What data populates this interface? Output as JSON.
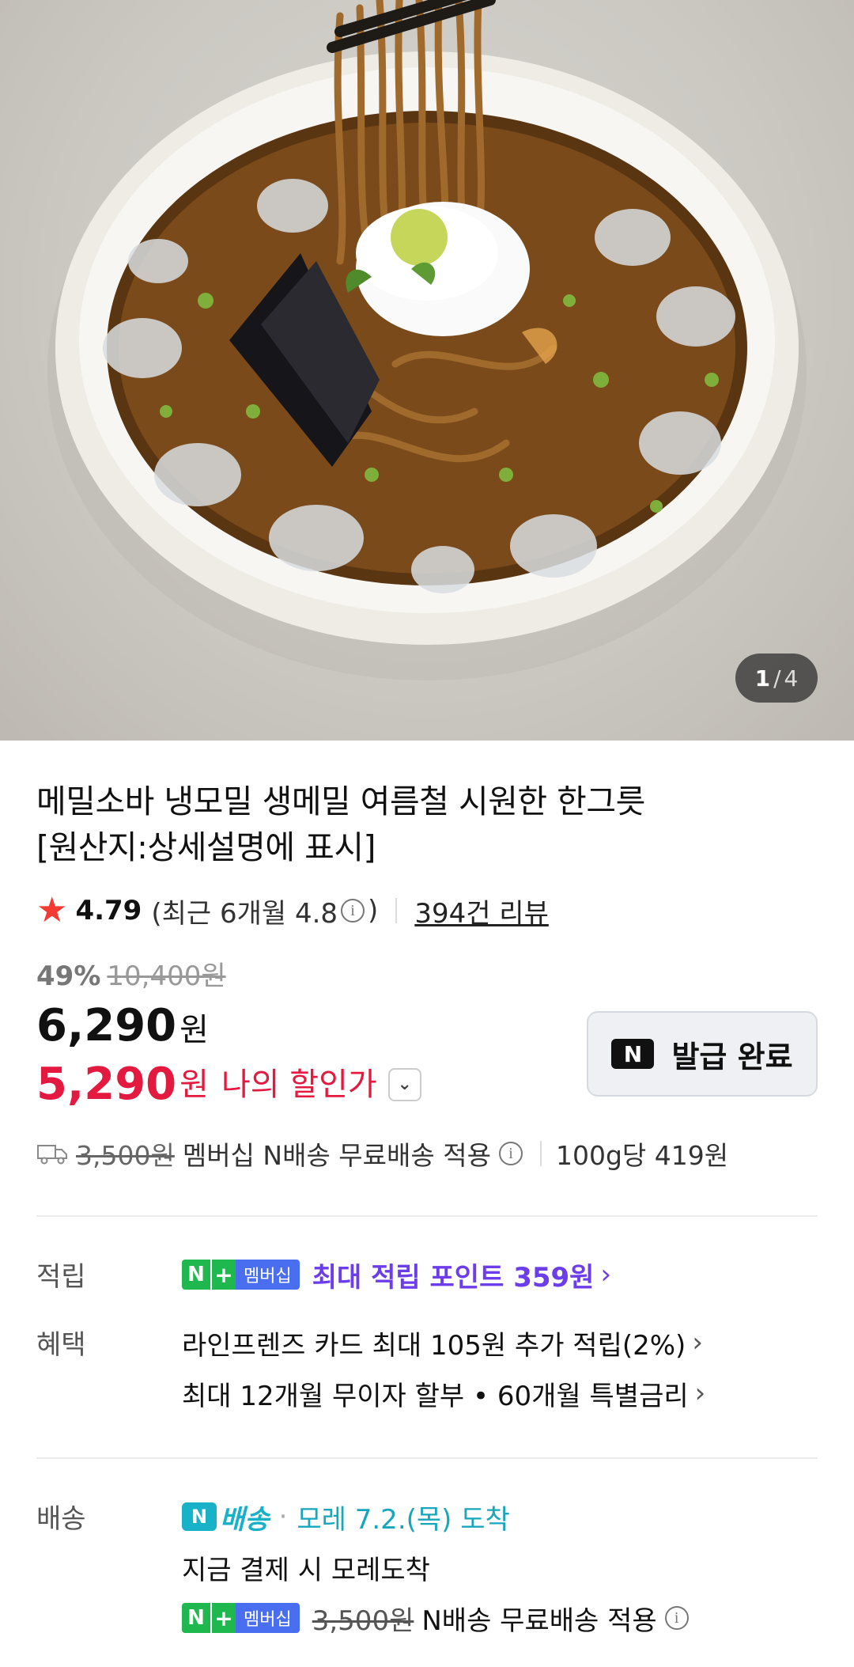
{
  "gallery": {
    "current": "1",
    "separator": "/",
    "total": "4"
  },
  "product": {
    "title_line1": "메밀소바 냉모밀 생메밀 여름철 시원한 한그릇",
    "title_line2": "[원산지:상세설명에 표시]"
  },
  "rating": {
    "score": "4.79",
    "recent_prefix": "(최근 6개월 4.8",
    "recent_suffix": ")",
    "reviews": "394건 리뷰"
  },
  "price": {
    "discount_pct": "49%",
    "original": "10,400원",
    "sale": "6,290",
    "sale_unit": "원",
    "my_price": "5,290",
    "my_unit": "원",
    "my_label": "나의 할인가",
    "coupon_label": "발급 완료"
  },
  "shipping_summary": {
    "fee": "3,500원",
    "text": "멤버십 N배송 무료배송 적용",
    "unit_price": "100g당 419원"
  },
  "benefits": {
    "points_label": "적립",
    "badge_n": "N",
    "badge_plus": "+",
    "badge_text": "멤버십",
    "points_text": "최대 적립 포인트 359원",
    "benefit_label": "혜택",
    "card_text": "라인프렌즈 카드 최대 105원 추가 적립(2%)",
    "installment_text": "최대 12개월 무이자 할부 • 60개월 특별금리"
  },
  "delivery": {
    "label": "배송",
    "service": "배송",
    "eta": "모레 7.2.(목) 도착",
    "note": "지금 결제 시 모레도착",
    "fee": "3,500원",
    "free_text": "N배송 무료배송 적용"
  },
  "colors": {
    "sale_red": "#e3193f",
    "purple": "#6c3dea",
    "teal": "#18b2c8",
    "star": "#f43b33",
    "green": "#1fb84e"
  }
}
